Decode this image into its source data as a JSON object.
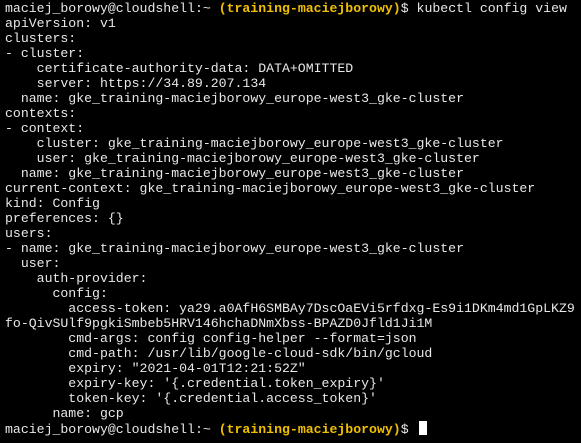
{
  "prompt": {
    "user_host": "maciej_borowy@cloudshell",
    "path": ":~ ",
    "project": "(training-maciejborowy)",
    "symbol": "$ "
  },
  "command": "kubectl config view",
  "output_lines": [
    "apiVersion: v1",
    "clusters:",
    "- cluster:",
    "    certificate-authority-data: DATA+OMITTED",
    "    server: https://34.89.207.134",
    "  name: gke_training-maciejborowy_europe-west3_gke-cluster",
    "contexts:",
    "- context:",
    "    cluster: gke_training-maciejborowy_europe-west3_gke-cluster",
    "    user: gke_training-maciejborowy_europe-west3_gke-cluster",
    "  name: gke_training-maciejborowy_europe-west3_gke-cluster",
    "current-context: gke_training-maciejborowy_europe-west3_gke-cluster",
    "kind: Config",
    "preferences: {}",
    "users:",
    "- name: gke_training-maciejborowy_europe-west3_gke-cluster",
    "  user:",
    "    auth-provider:",
    "      config:",
    "        access-token: ya29.a0AfH6SMBAy7DscOaEVi5rfdxg-Es9i1DKm4md1GpLKZ9",
    "fo-QivSUlf9pgkiSmbeb5HRV146hchaDNmXbss-BPAZD0Jfld1Ji1M",
    "        cmd-args: config config-helper --format=json",
    "        cmd-path: /usr/lib/google-cloud-sdk/bin/gcloud",
    "        expiry: \"2021-04-01T12:21:52Z\"",
    "        expiry-key: '{.credential.token_expiry}'",
    "        token-key: '{.credential.access_token}'",
    "      name: gcp"
  ],
  "colors": {
    "background": "#000000",
    "text": "#e8e8e8",
    "project": "#f0c000",
    "cursor": "#ffffff"
  }
}
